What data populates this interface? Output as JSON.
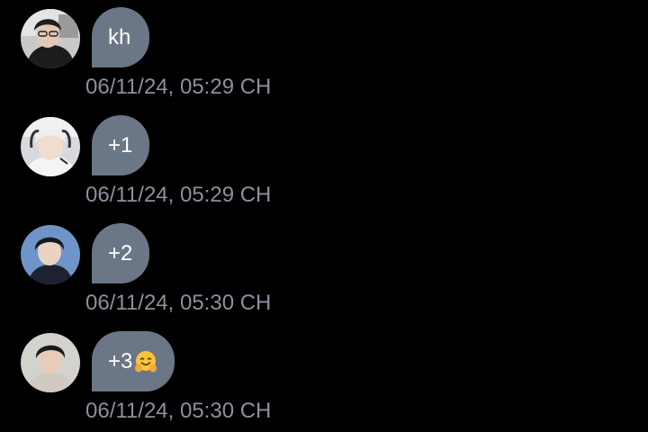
{
  "messages": [
    {
      "avatar": "user-avatar-1",
      "text": "kh",
      "timestamp": "06/11/24, 05:29 CH"
    },
    {
      "avatar": "user-avatar-2",
      "text": "+1",
      "timestamp": "06/11/24, 05:29 CH"
    },
    {
      "avatar": "user-avatar-3",
      "text": "+2",
      "timestamp": "06/11/24, 05:30 CH"
    },
    {
      "avatar": "user-avatar-4",
      "text": "+3",
      "emoji": "hugging-face-emoji",
      "timestamp": "06/11/24, 05:30 CH"
    }
  ],
  "colors": {
    "background": "#000000",
    "bubble": "#6b7686",
    "bubble_text": "#ffffff",
    "timestamp": "#8a919c"
  }
}
